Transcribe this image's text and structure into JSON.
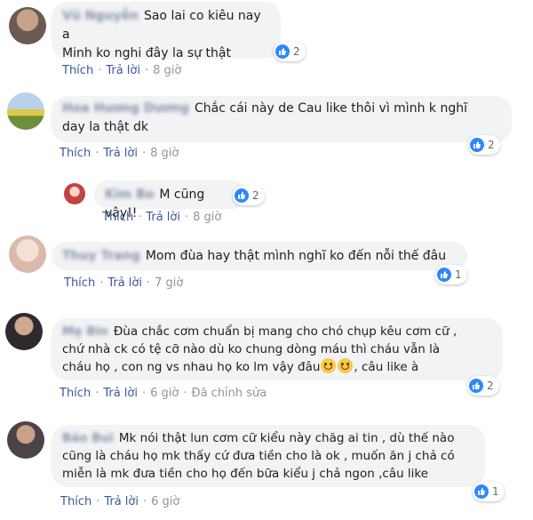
{
  "comments": [
    {
      "author": "Vũ Nguyễn",
      "lines": [
        "Sao lai co kiêu nay a",
        "Minh ko nghi đây la sự thật"
      ],
      "like_label": "Thích",
      "reply_label": "Trả lời",
      "time": "8 giờ",
      "reactions": "2"
    },
    {
      "author": "Hoa Hương Dương",
      "lines": [
        "Chắc cái này de Cau like thôi vì mình k nghĩ",
        "day la thật dk"
      ],
      "like_label": "Thích",
      "reply_label": "Trả lời",
      "time": "8 giờ",
      "reactions": "2"
    },
    {
      "author": "Kim Bo",
      "lines": [
        "M cũng vậy!!"
      ],
      "like_label": "Thích",
      "reply_label": "Trả lời",
      "time": "8 giờ",
      "reactions": "2"
    },
    {
      "author": "Thuy Trang",
      "lines": [
        "Mom đùa hay thật mình nghĩ ko đến nỗi thế đâu"
      ],
      "like_label": "Thích",
      "reply_label": "Trả lời",
      "time": "7 giờ",
      "reactions": "1"
    },
    {
      "author": "Mẹ Bin",
      "lines": [
        "Đùa chắc cơm chuẩn bị mang cho chó chụp kêu cơm cữ ,",
        "chứ nhà ck có tệ cỡ nào dù ko chung dòng máu thì cháu vẫn là",
        "cháu họ , con ng vs nhau họ ko lm vậy đâu",
        ", câu like à"
      ],
      "like_label": "Thích",
      "reply_label": "Trả lời",
      "time": "6 giờ",
      "edited": "Đã chỉnh sửa",
      "reactions": "2"
    },
    {
      "author": "Bảo Bui",
      "lines": [
        "Mk nói thật lun cơm cữ kiểu này chăg ai tin , dù thế nào",
        "cũng là cháu họ mk thấy cứ đưa tiền cho là ok , muốn ăn j chả có",
        "miễn là mk đưa tiền cho họ đến bữa kiểu j chả ngon ,câu like"
      ],
      "like_label": "Thích",
      "reply_label": "Trả lời",
      "time": "6 giờ",
      "reactions": "1"
    }
  ],
  "colors": {
    "bubble": "#f2f3f5",
    "link": "#385898",
    "like": "#2d88ff"
  },
  "icons": {
    "like": "thumbs-up-icon",
    "emoji": "smiling-face-icon"
  }
}
